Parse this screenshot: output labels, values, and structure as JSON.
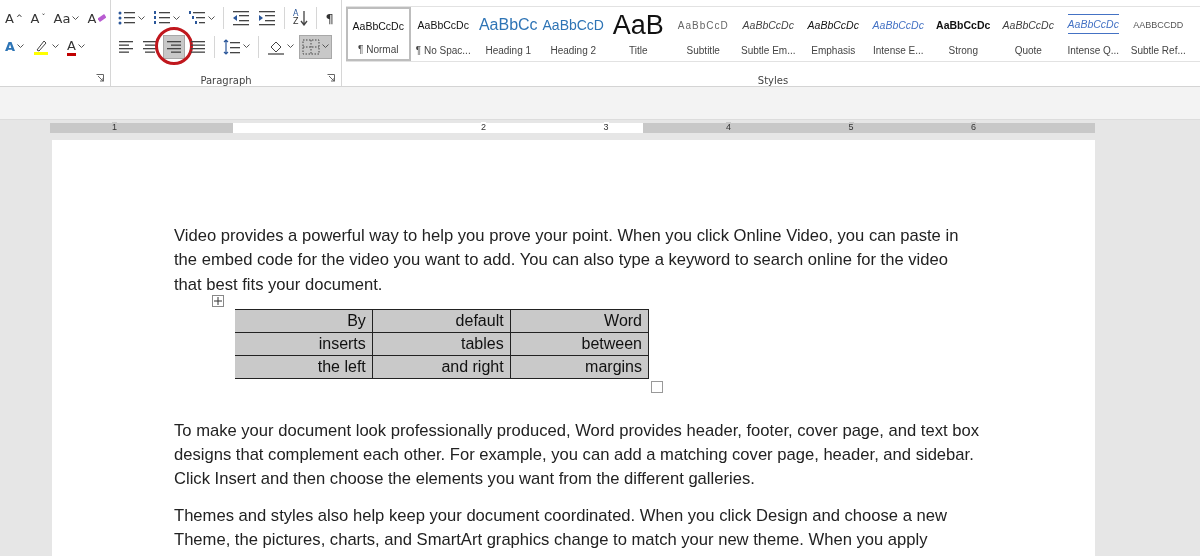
{
  "font_group": {
    "row1": [
      {
        "kind": "glyph",
        "text": "A",
        "super": "^"
      },
      {
        "kind": "glyph",
        "text": "A",
        "super": "ˇ"
      },
      {
        "kind": "glyph",
        "text": "Aa",
        "dropdown": true
      },
      {
        "kind": "clear",
        "text": "A"
      }
    ],
    "row2": [
      {
        "kind": "effects",
        "text": "A",
        "dropdown": true
      },
      {
        "kind": "highlight",
        "dropdown": true
      },
      {
        "kind": "fontcolor",
        "text": "A",
        "dropdown": true
      }
    ],
    "launcher": true
  },
  "paragraph_group": {
    "label": "Paragraph",
    "row1": [
      {
        "kind": "bullets",
        "dropdown": true,
        "selected": false
      },
      {
        "kind": "numbering",
        "dropdown": true,
        "selected": false
      },
      {
        "kind": "multilevel",
        "dropdown": true,
        "selected": false
      },
      {
        "kind": "sep"
      },
      {
        "kind": "outdent",
        "selected": false
      },
      {
        "kind": "indent",
        "selected": false
      },
      {
        "kind": "sep"
      },
      {
        "kind": "sort",
        "top": "A",
        "bottom": "Z",
        "selected": false
      },
      {
        "kind": "sep"
      },
      {
        "kind": "pilcrow",
        "text": "¶",
        "selected": false
      }
    ],
    "row2": [
      {
        "kind": "align-left",
        "selected": false,
        "circled": false
      },
      {
        "kind": "align-center",
        "selected": false,
        "circled": false
      },
      {
        "kind": "align-right",
        "selected": true,
        "circled": true
      },
      {
        "kind": "justify",
        "selected": false,
        "circled": false
      },
      {
        "kind": "sep"
      },
      {
        "kind": "spacing",
        "dropdown": true,
        "selected": false
      },
      {
        "kind": "sep"
      },
      {
        "kind": "shading",
        "dropdown": true,
        "selected": false
      },
      {
        "kind": "borders",
        "dropdown": true,
        "selected": true
      }
    ]
  },
  "styles_group": {
    "label": "Styles",
    "items": [
      {
        "preview": "AaBbCcDc",
        "name": "¶ Normal",
        "kind": "normal",
        "selected": true
      },
      {
        "preview": "AaBbCcDc",
        "name": "¶ No Spac...",
        "kind": "normal",
        "selected": false
      },
      {
        "preview": "AaBbCc",
        "name": "Heading 1",
        "kind": "heading1",
        "selected": false
      },
      {
        "preview": "AaBbCcD",
        "name": "Heading 2",
        "kind": "heading2",
        "selected": false
      },
      {
        "preview": "AaB",
        "name": "Title",
        "kind": "title",
        "selected": false
      },
      {
        "preview": "AaBbCcD",
        "name": "Subtitle",
        "kind": "subtitle",
        "selected": false
      },
      {
        "preview": "AaBbCcDc",
        "name": "Subtle Em...",
        "kind": "subtle",
        "selected": false
      },
      {
        "preview": "AaBbCcDc",
        "name": "Emphasis",
        "kind": "emphasis",
        "selected": false
      },
      {
        "preview": "AaBbCcDc",
        "name": "Intense E...",
        "kind": "intense",
        "selected": false
      },
      {
        "preview": "AaBbCcDc",
        "name": "Strong",
        "kind": "strong",
        "selected": false
      },
      {
        "preview": "AaBbCcDc",
        "name": "Quote",
        "kind": "quote",
        "selected": false
      },
      {
        "preview": "AaBbCcDc",
        "name": "Intense Q...",
        "kind": "intensequote",
        "selected": false
      },
      {
        "preview": "AABBCCDD",
        "name": "Subtle Ref...",
        "kind": "subtleref",
        "selected": false
      }
    ]
  },
  "ruler": {
    "numbers": [
      "1",
      "2",
      "3",
      "4",
      "5",
      "6"
    ]
  },
  "document": {
    "blocks": [
      {
        "kind": "paragraph",
        "text": "Video provides a powerful way to help you prove your point. When you click Online Video, you can paste in the embed code for the video you want to add. You can also type a keyword to search online for the video that best fits your document."
      },
      {
        "kind": "table",
        "rows": [
          [
            "By",
            "default",
            "Word"
          ],
          [
            "inserts",
            "tables",
            "between"
          ],
          [
            "the left",
            "and right",
            "margins"
          ]
        ]
      },
      {
        "kind": "paragraph",
        "text": "To make your document look professionally produced, Word provides header, footer, cover page, and text box designs that complement each other. For example, you can add a matching cover page, header, and sidebar. Click Insert and then choose the elements you want from the different galleries."
      },
      {
        "kind": "paragraph",
        "text": "Themes and styles also help keep your document coordinated. When you click Design and choose a new Theme, the pictures, charts, and SmartArt graphics change to match your new theme. When you apply"
      }
    ]
  }
}
